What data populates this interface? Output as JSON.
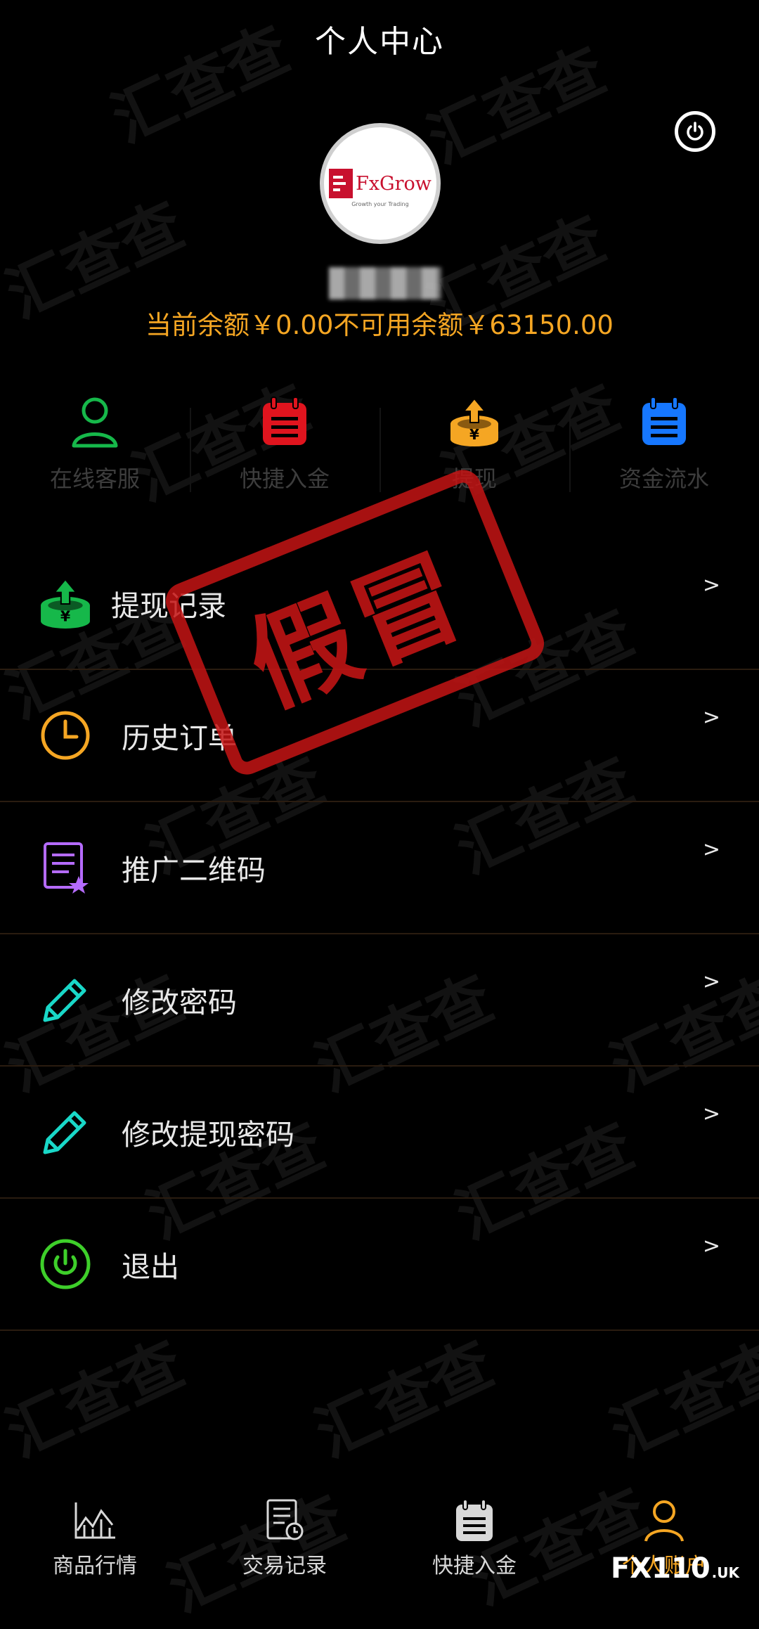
{
  "header": {
    "title": "个人中心"
  },
  "profile": {
    "logo_text": "FxGrow",
    "logo_sub": "Growth your Trading",
    "balance_text": "当前余额￥0.00不可用余额￥63150.00"
  },
  "quick_actions": [
    {
      "label": "在线客服",
      "icon": "user-icon",
      "color": "#16b84a"
    },
    {
      "label": "快捷入金",
      "icon": "calendar-icon",
      "color": "#e0141e"
    },
    {
      "label": "提现",
      "icon": "withdraw-icon",
      "color": "#f5a623"
    },
    {
      "label": "资金流水",
      "icon": "ledger-icon",
      "color": "#1677ff"
    }
  ],
  "menu": [
    {
      "label": "提现记录",
      "arrow": ">",
      "icon": "withdraw-record-icon",
      "color": "#16b84a"
    },
    {
      "label": "历史订单",
      "arrow": ">",
      "icon": "clock-icon",
      "color": "#f5a623"
    },
    {
      "label": "推广二维码",
      "arrow": ">",
      "icon": "document-star-icon",
      "color": "#b56bff"
    },
    {
      "label": "修改密码",
      "arrow": ">",
      "icon": "pencil-icon",
      "color": "#19d8c8"
    },
    {
      "label": "修改提现密码",
      "arrow": ">",
      "icon": "pencil-icon",
      "color": "#19d8c8"
    },
    {
      "label": "退出",
      "arrow": ">",
      "icon": "power-icon",
      "color": "#3ecf2a"
    }
  ],
  "stamp": {
    "text": "假冒"
  },
  "watermark": {
    "text": "汇查查"
  },
  "tabs": [
    {
      "label": "商品行情",
      "icon": "chart-icon"
    },
    {
      "label": "交易记录",
      "icon": "record-icon"
    },
    {
      "label": "快捷入金",
      "icon": "calendar-icon"
    },
    {
      "label": "个人账户",
      "icon": "person-icon",
      "active": true
    }
  ],
  "badge": {
    "main": "FX110",
    "sub": ".UK"
  },
  "colors": {
    "accent": "#f5a623",
    "background": "#000000"
  }
}
